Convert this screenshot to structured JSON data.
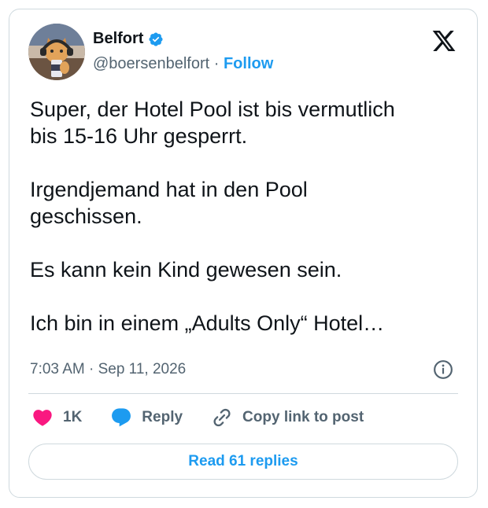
{
  "author": {
    "name": "Belfort",
    "handle": "@boersenbelfort",
    "separator": "·",
    "follow_label": "Follow"
  },
  "tweet": {
    "text": "Super, der Hotel Pool ist bis vermutlich\nbis 15-16 Uhr gesperrt.\n\nIrgendjemand hat in den Pool\ngeschissen.\n\nEs kann kein Kind gewesen sein.\n\nIch bin in einem „Adults Only“ Hotel…",
    "timestamp": "7:03 AM · Sep 11, 2026"
  },
  "actions": {
    "likes_count": "1K",
    "reply_label": "Reply",
    "copy_link_label": "Copy link to post"
  },
  "read_replies_label": "Read 61 replies",
  "colors": {
    "accent": "#1d9bf0",
    "heart": "#f91880",
    "muted": "#536471",
    "border": "#cfd9de"
  },
  "icons": [
    "verified-badge-icon",
    "x-logo-icon",
    "info-icon",
    "heart-icon",
    "reply-bubble-icon",
    "link-icon"
  ]
}
